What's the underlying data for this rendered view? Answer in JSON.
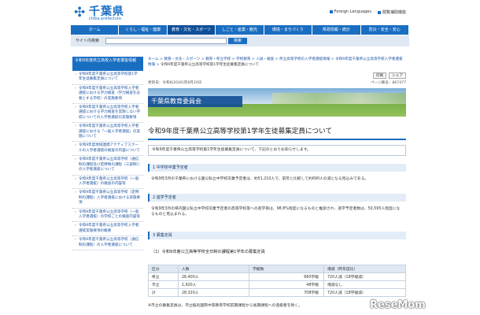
{
  "header": {
    "logo_text": "千葉県",
    "logo_sub": "chiba prefecture",
    "links": [
      "Foreign Languages",
      "閲覧補助機能"
    ]
  },
  "nav": {
    "items": [
      "ホーム",
      "くらし・福祉・健康",
      "教育・文化・スポーツ",
      "しごと・産業・観光",
      "環境・まちづくり",
      "県政情報・統計",
      "防災・安全・安心"
    ],
    "active_index": 2
  },
  "search": {
    "label": "サイト内検索",
    "button": "検索",
    "placeholder": ""
  },
  "sidebar": {
    "heading": "令和9年度県立高校入学者選抜情報",
    "items": [
      "令和9年度千葉県公立高等学校第1学年生徒募集定員について",
      "令和9年度千葉県公立高等学校入学者選抜における学力検査（学力検査を必要とする学校）の実施要項",
      "令和9年度千葉県公立高等学校入学者選抜における学力検査を実施しない学校についての入学者選抜の実施要項",
      "令和9年度千葉県公立高等学校入学者選抜における「一般入学者選抜」の実施について",
      "令和9年度地域連携アクティブスクールの入学者選抜の検査の内容について",
      "令和9年度千葉県公立高等学校（通信制の課程及び定時制の課程（三部制））の入学者選抜について",
      "令和9年度千葉県公立高等学校（一般入学者選抜）の検査の内容等",
      "令和9年度千葉県公立高等学校（定時制の課程）入学者選抜における実施要項",
      "令和9年度千葉県公立高等学校（一般入学者選抜）の学校ごとの検査内容等",
      "令和9年度千葉県公立高等学校入学者選抜実施要項の概要",
      "令和9年度千葉県公立高等学校（通信制の課程）の入学者選抜について"
    ]
  },
  "breadcrumb": {
    "links": [
      "ホーム",
      "教育・文化・スポーツ",
      "教育・県立学校",
      "学校教育",
      "入試・検査",
      "県立高等学校の入学者選抜情報",
      "令和9年度千葉県公立高等学校入学者選抜情報"
    ],
    "current": "令和9年度千葉県公立高等学校第1学年生徒募集定員について"
  },
  "meta": {
    "updated": "更新日：令和8(2026)年8月20日",
    "page_id": "ページ番号：867477"
  },
  "share": [
    "印刷",
    "シェア"
  ],
  "banner": {
    "title": "千葉県教育委員会"
  },
  "page_title": "令和9年度千葉県公立高等学校第1学年生徒募集定員について",
  "lead": "令和9年度千葉県公立高等学校第1学年生徒募集定員について、下記のとおりお知らせします。",
  "sections": [
    {
      "heading": "1 中学校卒業予定者",
      "text": "令和9年3月の千葉県における国公私立中学校卒業予定者は、約51,210人で、前年と比較して約690人の減となる見込みである。"
    },
    {
      "heading": "2 進学予定者",
      "text": "令和9年3月の県内国公私立中学校卒業予定者の高等学校等への進学率は、98.8%程度になるものと推測され、進学予定者数は、50,595人程度になるものと見込まれる。"
    },
    {
      "heading": "3 募集定員",
      "text": ""
    }
  ],
  "table": {
    "caption": "（1）令和9年度公立高等学校全日制の課程第1学年の募集定員",
    "headers": [
      "区分",
      "人数",
      "学級数",
      "増減（昨年度比）"
    ],
    "rows": [
      [
        "県立",
        "26,400人",
        "660学級",
        "720人減（18学級減）"
      ],
      [
        "市立",
        "1,920人",
        "48学級",
        "増減なし"
      ],
      [
        "計",
        "28,320人",
        "708学級",
        "720人減（18学級減）"
      ]
    ],
    "note": "※市立の募集定員は、市立稲毛国際中等教育学校前期課程から後期課程への進級者を除く。"
  },
  "watermark": "ReseMom"
}
